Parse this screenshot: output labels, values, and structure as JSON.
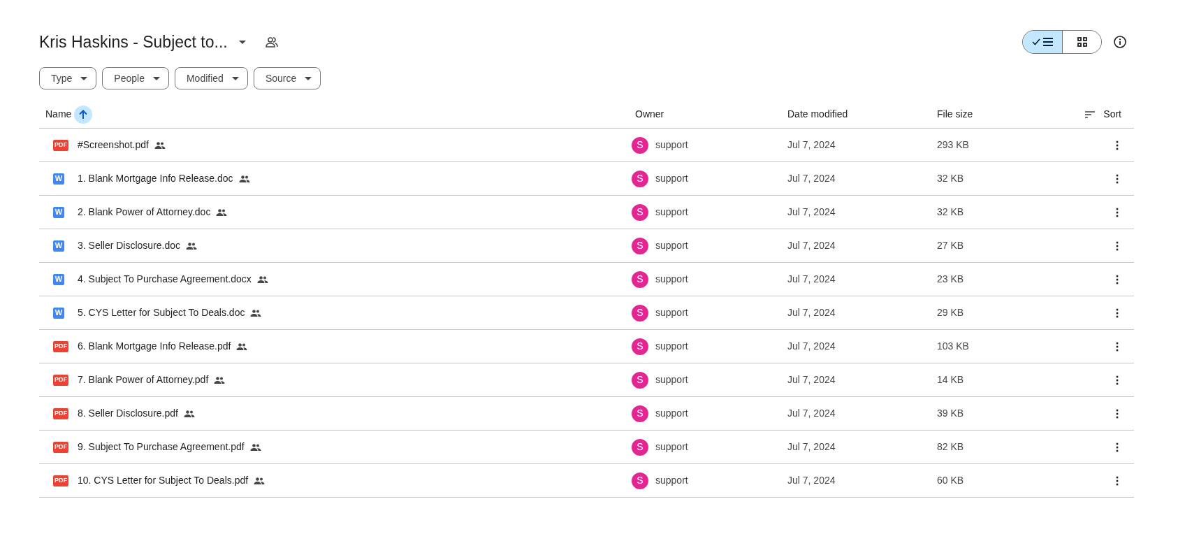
{
  "header": {
    "title": "Kris Haskins - Subject to..."
  },
  "view_toggle": [
    {
      "kind": "list",
      "selected": true
    },
    {
      "kind": "grid",
      "selected": false
    }
  ],
  "filters": [
    "Type",
    "People",
    "Modified",
    "Source"
  ],
  "table": {
    "columns": [
      "Name",
      "Owner",
      "Date modified",
      "File size"
    ],
    "sort_label": "Sort",
    "rows": [
      {
        "kind": "pdf",
        "icon_text": "PDF",
        "name": "#Screenshot.pdf",
        "avatar": "S",
        "owner": "support",
        "date": "Jul 7, 2024",
        "size": "293 KB"
      },
      {
        "kind": "doc",
        "icon_text": "W",
        "name": "1. Blank Mortgage Info Release.doc",
        "avatar": "S",
        "owner": "support",
        "date": "Jul 7, 2024",
        "size": "32 KB"
      },
      {
        "kind": "doc",
        "icon_text": "W",
        "name": "2. Blank Power of Attorney.doc",
        "avatar": "S",
        "owner": "support",
        "date": "Jul 7, 2024",
        "size": "32 KB"
      },
      {
        "kind": "doc",
        "icon_text": "W",
        "name": "3. Seller Disclosure.doc",
        "avatar": "S",
        "owner": "support",
        "date": "Jul 7, 2024",
        "size": "27 KB"
      },
      {
        "kind": "doc",
        "icon_text": "W",
        "name": "4. Subject To Purchase Agreement.docx",
        "avatar": "S",
        "owner": "support",
        "date": "Jul 7, 2024",
        "size": "23 KB"
      },
      {
        "kind": "doc",
        "icon_text": "W",
        "name": "5. CYS Letter for Subject To Deals.doc",
        "avatar": "S",
        "owner": "support",
        "date": "Jul 7, 2024",
        "size": "29 KB"
      },
      {
        "kind": "pdf",
        "icon_text": "PDF",
        "name": "6. Blank Mortgage Info Release.pdf",
        "avatar": "S",
        "owner": "support",
        "date": "Jul 7, 2024",
        "size": "103 KB"
      },
      {
        "kind": "pdf",
        "icon_text": "PDF",
        "name": "7. Blank Power of Attorney.pdf",
        "avatar": "S",
        "owner": "support",
        "date": "Jul 7, 2024",
        "size": "14 KB"
      },
      {
        "kind": "pdf",
        "icon_text": "PDF",
        "name": "8. Seller Disclosure.pdf",
        "avatar": "S",
        "owner": "support",
        "date": "Jul 7, 2024",
        "size": "39 KB"
      },
      {
        "kind": "pdf",
        "icon_text": "PDF",
        "name": "9. Subject To Purchase Agreement.pdf",
        "avatar": "S",
        "owner": "support",
        "date": "Jul 7, 2024",
        "size": "82 KB"
      },
      {
        "kind": "pdf",
        "icon_text": "PDF",
        "name": "10. CYS Letter for Subject To Deals.pdf",
        "avatar": "S",
        "owner": "support",
        "date": "Jul 7, 2024",
        "size": "60 KB"
      }
    ]
  }
}
